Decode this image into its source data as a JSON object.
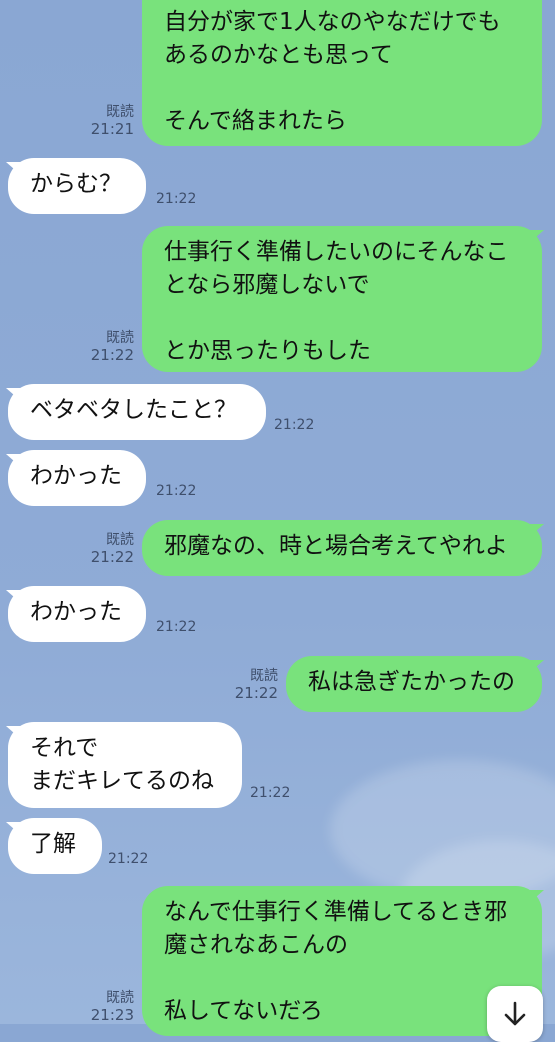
{
  "messages": [
    {
      "dir": "out",
      "text": "自分が家で1人なのやなだけでも\nあるのかなとも思って\n\nそんで絡まれたら",
      "read": "既読",
      "time": "21:21"
    },
    {
      "dir": "in",
      "text": "からむ？",
      "time": "21:22"
    },
    {
      "dir": "out",
      "text": "仕事行く準備したいのにそんなこ\nとなら邪魔しないで\n\nとか思ったりもした",
      "read": "既読",
      "time": "21:22"
    },
    {
      "dir": "in",
      "text": "ベタベタしたこと？",
      "time": "21:22"
    },
    {
      "dir": "in",
      "text": "わかった",
      "time": "21:22"
    },
    {
      "dir": "out",
      "text": "邪魔なの、時と場合考えてやれよ",
      "read": "既読",
      "time": "21:22"
    },
    {
      "dir": "in",
      "text": "わかった",
      "time": "21:22"
    },
    {
      "dir": "out",
      "text": "私は急ぎたかったの",
      "read": "既読",
      "time": "21:22"
    },
    {
      "dir": "in",
      "text": "それで\nまだキレてるのね",
      "time": "21:22"
    },
    {
      "dir": "in",
      "text": "了解",
      "time": "21:22"
    },
    {
      "dir": "out",
      "text": "なんで仕事行く準備してるとき邪\n魔されなあこんの\n\n私してないだろ",
      "read": "既読",
      "time": "21:23"
    }
  ],
  "scroll_button": {
    "icon": "arrow-down-icon"
  }
}
